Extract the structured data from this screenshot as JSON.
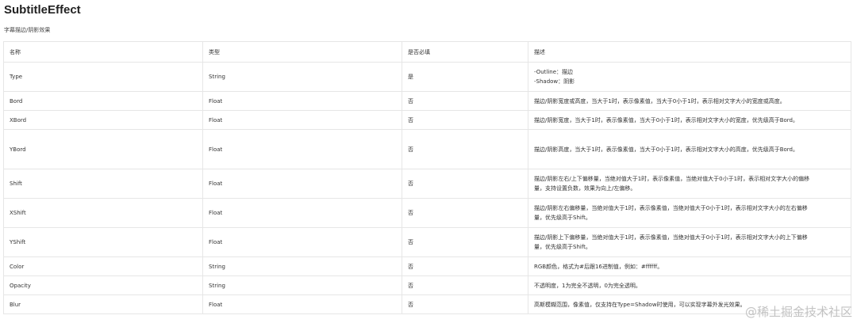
{
  "title": "SubtitleEffect",
  "subtitle": "字幕描边/阴影效果",
  "table": {
    "headers": [
      "名称",
      "类型",
      "是否必填",
      "描述"
    ],
    "rows": [
      {
        "name": "Type",
        "type": "String",
        "required": "是",
        "desc": [
          "-Outline：描边",
          "-Shadow：阴影"
        ]
      },
      {
        "name": "Bord",
        "type": "Float",
        "required": "否",
        "desc": [
          "描边/阴影宽度或高度，当大于1时，表示像素值，当大于0小于1时，表示相对文字大小的宽度或高度。"
        ]
      },
      {
        "name": "XBord",
        "type": "Float",
        "required": "否",
        "desc": [
          "描边/阴影宽度，当大于1时，表示像素值，当大于0小于1时，表示相对文字大小的宽度，优先级高于Bord。"
        ]
      },
      {
        "name": "YBord",
        "type": "Float",
        "required": "否",
        "desc": [
          "描边/阴影高度，当大于1时，表示像素值，当大于0小于1时，表示相对文字大小的高度，优先级高于Bord。"
        ]
      },
      {
        "name": "Shift",
        "type": "Float",
        "required": "否",
        "desc": [
          "描边/阴影左右/上下偏移量，当绝对值大于1时，表示像素值，当绝对值大于0小于1时，表示相对文字大小的偏移",
          "量，支持设置负数，效果为向上/左偏移。"
        ]
      },
      {
        "name": "XShift",
        "type": "Float",
        "required": "否",
        "desc": [
          "描边/阴影左右偏移量，当绝对值大于1时，表示像素值，当绝对值大于0小于1时，表示相对文字大小的左右偏移",
          "量，优先级高于Shift。"
        ]
      },
      {
        "name": "YShift",
        "type": "Float",
        "required": "否",
        "desc": [
          "描边/阴影上下偏移量，当绝对值大于1时，表示像素值，当绝对值大于0小于1时，表示相对文字大小的上下偏移",
          "量，优先级高于Shift。"
        ]
      },
      {
        "name": "Color",
        "type": "String",
        "required": "否",
        "desc": [
          "RGB颜色，格式为#后跟16进制值，例如：#ffffff。"
        ]
      },
      {
        "name": "Opacity",
        "type": "String",
        "required": "否",
        "desc": [
          "不透明度，1为完全不透明，0为完全透明。"
        ]
      },
      {
        "name": "Blur",
        "type": "Float",
        "required": "否",
        "desc": [
          "高斯模糊范围，像素值，仅支持在Type=Shadow时使用，可以实现字幕外发光效果。"
        ]
      }
    ]
  },
  "watermark": "@稀土掘金技术社区"
}
